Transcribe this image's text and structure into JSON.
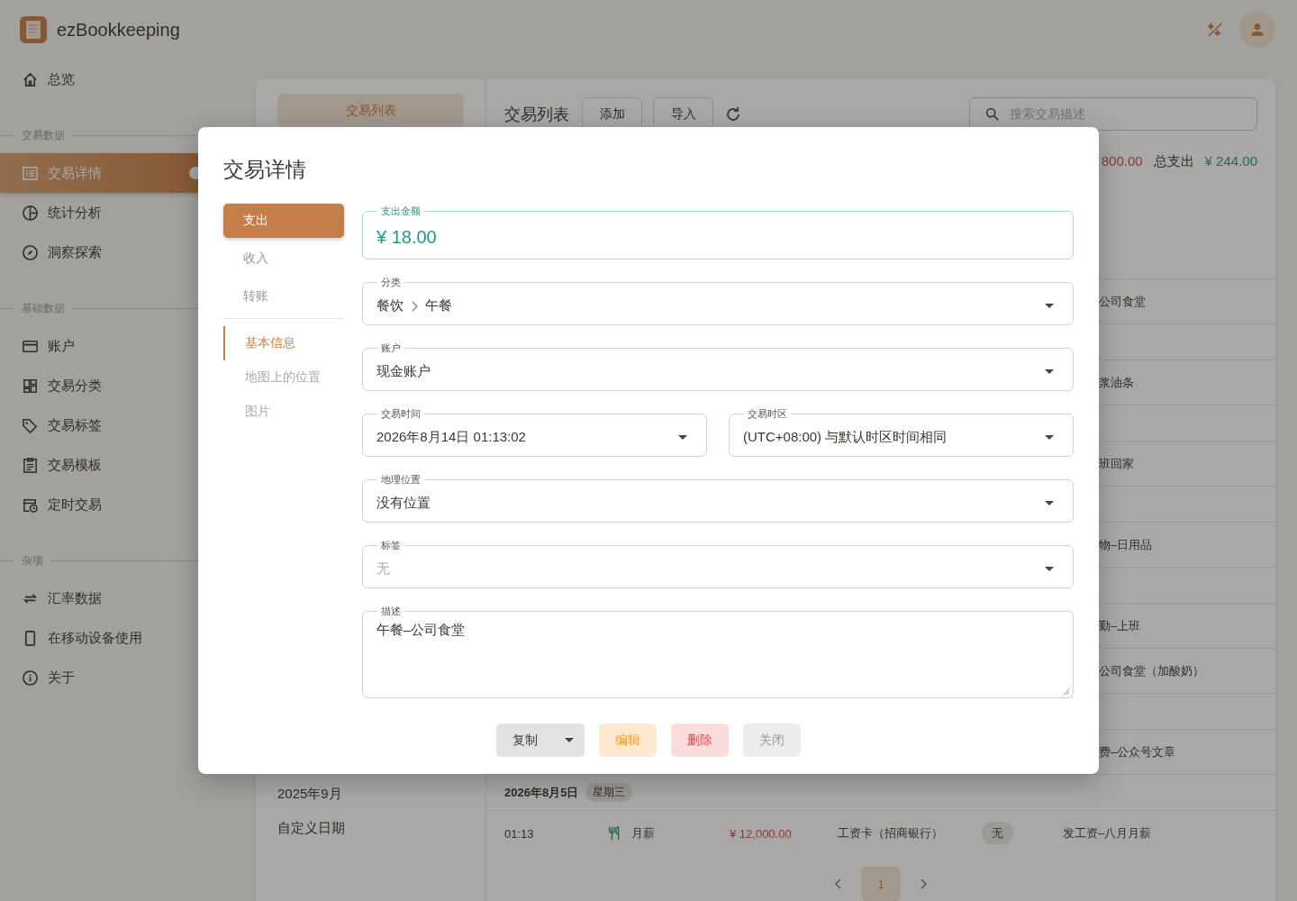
{
  "app": {
    "name": "ezBookkeeping"
  },
  "sidebar": {
    "groups": [
      {
        "items": [
          {
            "label": "总览",
            "selected": false
          }
        ]
      },
      {
        "heading": "交易数据",
        "items": [
          {
            "label": "交易详情",
            "selected": true
          },
          {
            "label": "统计分析",
            "selected": false
          },
          {
            "label": "洞察探索",
            "selected": false
          }
        ]
      },
      {
        "heading": "基础数据",
        "items": [
          {
            "label": "账户",
            "selected": false
          },
          {
            "label": "交易分类",
            "selected": false
          },
          {
            "label": "交易标签",
            "selected": false
          },
          {
            "label": "交易模板",
            "selected": false
          },
          {
            "label": "定时交易",
            "selected": false
          }
        ]
      },
      {
        "heading": "杂项",
        "items": [
          {
            "label": "汇率数据",
            "selected": false
          },
          {
            "label": "在移动设备使用",
            "selected": false
          },
          {
            "label": "关于",
            "selected": false
          }
        ]
      }
    ]
  },
  "list_panel": {
    "tab": "交易列表",
    "months": [
      "2025年9月",
      "自定义日期"
    ]
  },
  "toolbar": {
    "title": "交易列表",
    "buttons": [
      "添加",
      "导入"
    ],
    "search": {
      "placeholder": "搜索交易描述"
    }
  },
  "totals": {
    "income": "800.00",
    "expense_label": "总支出",
    "expense": "¥ 244.00"
  },
  "rows": [
    {
      "kind": "covered",
      "description": "公司食堂"
    },
    {
      "kind": "covered_date"
    },
    {
      "kind": "covered",
      "description": "浆油条"
    },
    {
      "kind": "covered_date"
    },
    {
      "kind": "covered",
      "description": "班回家"
    },
    {
      "kind": "covered_date"
    },
    {
      "kind": "covered",
      "description": "物–日用品"
    },
    {
      "kind": "covered_date"
    },
    {
      "kind": "covered",
      "description": "勤–上班"
    },
    {
      "kind": "covered",
      "description": "公司食堂（加酸奶）"
    },
    {
      "kind": "covered_date"
    },
    {
      "kind": "covered",
      "description": "费–公众号文章"
    },
    {
      "kind": "date",
      "date": "2026年8月5日",
      "weekday": "星期三"
    },
    {
      "kind": "transaction",
      "time": "01:13",
      "category": "月薪",
      "amount": "¥ 12,000.00",
      "account": "工资卡（招商银行）",
      "tag": "无",
      "description": "发工资–八月月薪"
    }
  ],
  "pagination": {
    "pages": [
      {
        "label": "1",
        "selected": true
      }
    ]
  },
  "dialog": {
    "title": "交易详情",
    "types": [
      {
        "label": "支出",
        "selected": true
      },
      {
        "label": "收入",
        "selected": false
      },
      {
        "label": "转账",
        "selected": false
      }
    ],
    "sections": [
      {
        "label": "基本信息",
        "selected": true
      },
      {
        "label": "地图上的位置",
        "selected": false
      },
      {
        "label": "图片",
        "selected": false
      }
    ],
    "amount": {
      "label": "支出金额",
      "value": "¥ 18.00"
    },
    "category": {
      "label": "分类",
      "parent": "餐饮",
      "child": "午餐"
    },
    "account": {
      "label": "账户",
      "value": "现金账户"
    },
    "time": {
      "label": "交易时间",
      "value": "2026年8月14日 01:13:02"
    },
    "timezone": {
      "label": "交易时区",
      "value": "(UTC+08:00) 与默认时区时间相同"
    },
    "location": {
      "label": "地理位置",
      "value": "没有位置"
    },
    "tags": {
      "label": "标签",
      "placeholder": "无"
    },
    "description": {
      "label": "描述",
      "value": "午餐–公司食堂"
    },
    "buttons": [
      {
        "label": "复制",
        "kind": "split"
      },
      {
        "label": "编辑",
        "kind": "edit"
      },
      {
        "label": "删除",
        "kind": "delete"
      },
      {
        "label": "关闭",
        "kind": "close"
      }
    ]
  }
}
